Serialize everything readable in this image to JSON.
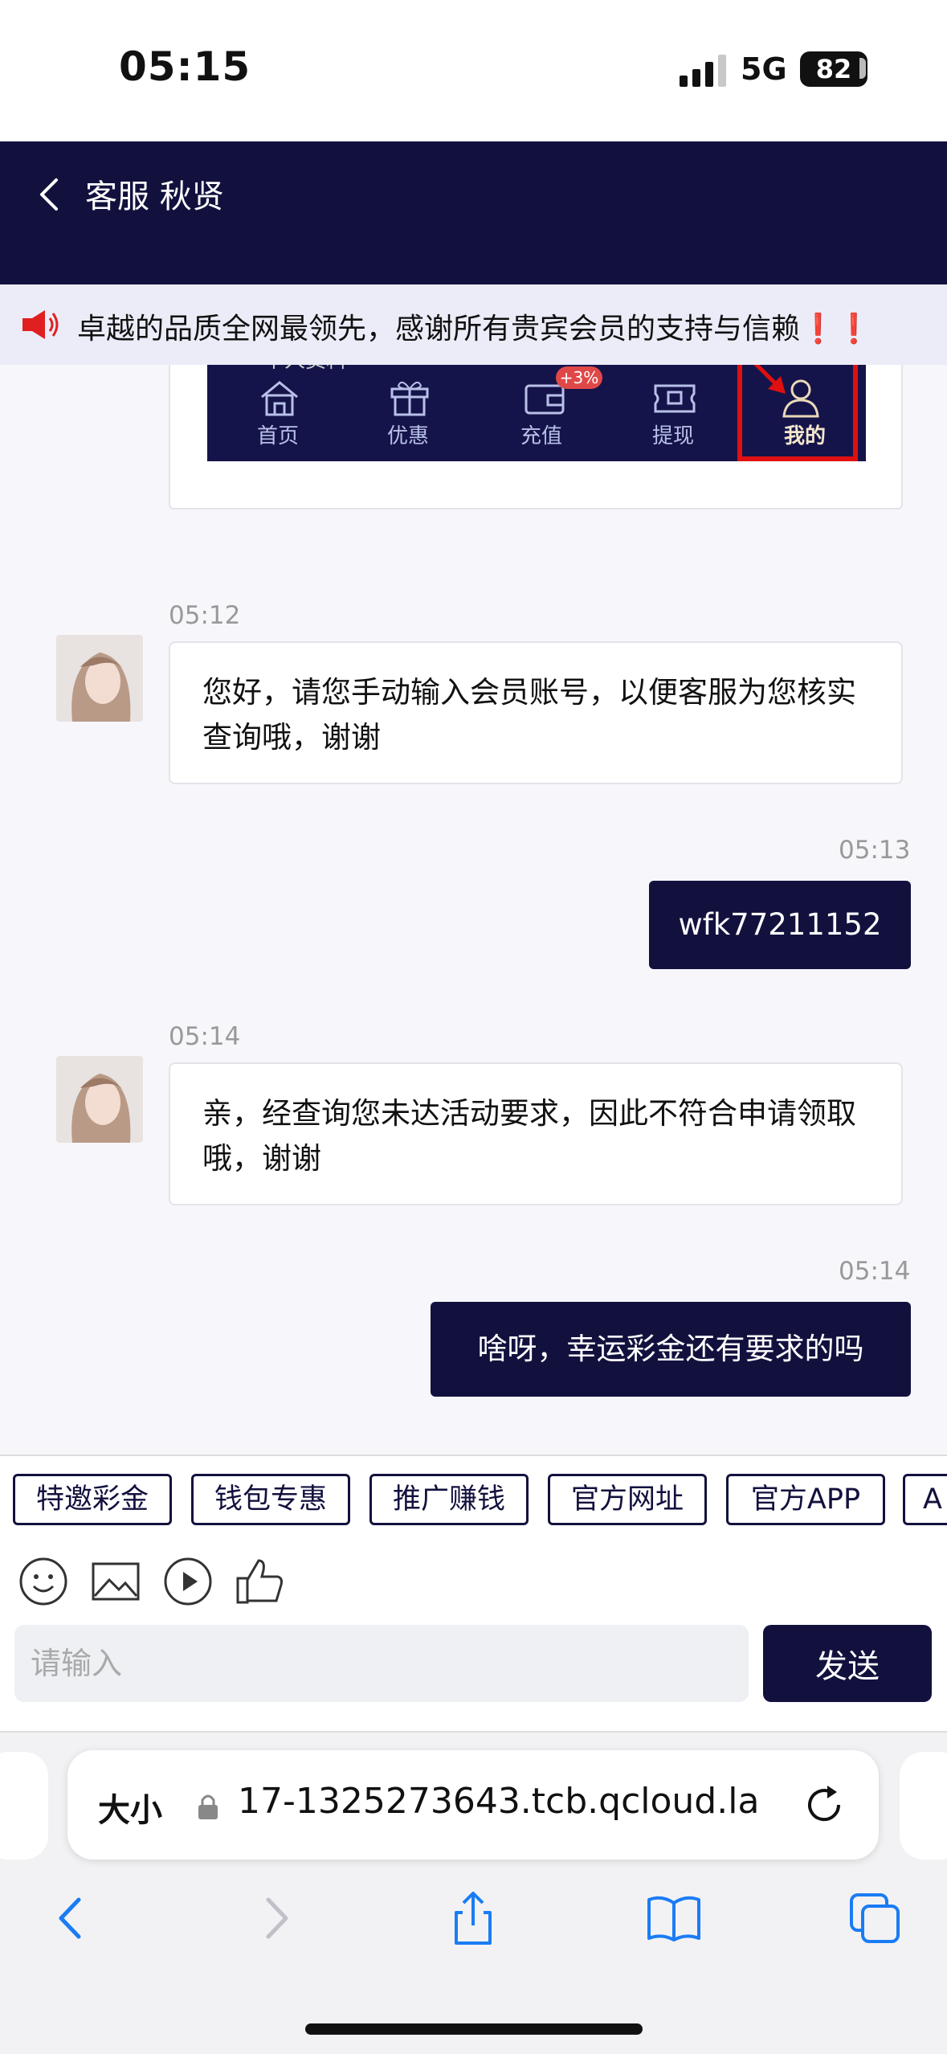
{
  "status_bar": {
    "time": "05:15",
    "network": "5G",
    "battery": "82"
  },
  "header": {
    "title": "客服 秋贤"
  },
  "notice": {
    "text": "卓越的品质全网最领先，感谢所有贵宾会员的支持与信赖❗❗"
  },
  "embedded_nav": {
    "items": [
      "首页",
      "优惠",
      "充值",
      "提现",
      "我的"
    ],
    "badge": "+3%",
    "top_fragment": "个人资料"
  },
  "messages": [
    {
      "time": "05:12",
      "side": "agent",
      "text": "您好，请您手动输入会员账号，以便客服为您核实查询哦，谢谢"
    },
    {
      "time": "05:13",
      "side": "user",
      "text": "wfk77211152"
    },
    {
      "time": "05:14",
      "side": "agent",
      "text": "亲，经查询您未达活动要求，因此不符合申请领取哦，谢谢"
    },
    {
      "time": "05:14",
      "side": "user",
      "text": "啥呀，幸运彩金还有要求的吗"
    }
  ],
  "quick_replies": [
    "特邀彩金",
    "钱包专惠",
    "推广赚钱",
    "官方网址",
    "官方APP",
    "A"
  ],
  "input": {
    "placeholder": "请输入",
    "send_label": "发送"
  },
  "browser": {
    "text_size_label": "大小",
    "url": "17-1325273643.tcb.qcloud.la"
  },
  "colors": {
    "primary": "#12113e",
    "notice_bg": "#ececf8",
    "accent_red": "#e02020"
  }
}
